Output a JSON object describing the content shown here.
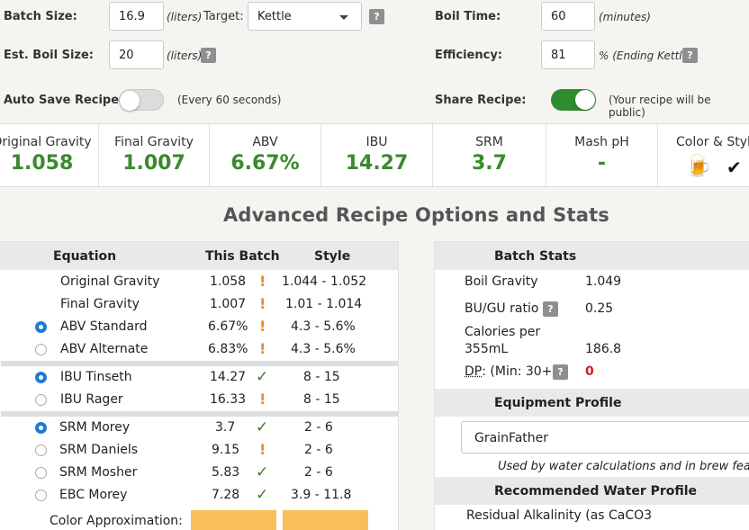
{
  "settings": {
    "batch_size_label": "Batch Size:",
    "batch_size_value": "16.9",
    "batch_size_unit": "(liters)",
    "target_label": "Target:",
    "target_value": "Kettle",
    "boil_time_label": "Boil Time:",
    "boil_time_value": "60",
    "boil_time_unit": "(minutes)",
    "est_boil_label": "Est. Boil Size:",
    "est_boil_value": "20",
    "est_boil_unit": "(liters)",
    "efficiency_label": "Efficiency:",
    "efficiency_value": "81",
    "efficiency_unit": "% (Ending Kettle)",
    "auto_save_label": "Auto Save Recipe:",
    "auto_save_note": "(Every 60 seconds)",
    "share_label": "Share Recipe:",
    "share_note": "(Your recipe will be public)",
    "help_glyph": "?"
  },
  "stats": [
    {
      "name": "Original Gravity",
      "value": "1.058"
    },
    {
      "name": "Final Gravity",
      "value": "1.007"
    },
    {
      "name": "ABV",
      "value": "6.67%"
    },
    {
      "name": "IBU",
      "value": "14.27"
    },
    {
      "name": "SRM",
      "value": "3.7"
    },
    {
      "name": "Mash pH",
      "value": "-"
    },
    {
      "name": "Color & Style",
      "value": ""
    }
  ],
  "stat_icons": {
    "beer": "🍺",
    "check": "✔"
  },
  "advanced_title": "Advanced Recipe Options and Stats",
  "equation_table": {
    "headers": {
      "equation": "Equation",
      "batch": "This Batch",
      "style": "Style"
    },
    "rows": [
      {
        "label": "Original Gravity",
        "batch": "1.058",
        "status": "!",
        "style": "1.044 - 1.052"
      },
      {
        "label": "Final Gravity",
        "batch": "1.007",
        "status": "!",
        "style": "1.01 - 1.014"
      },
      {
        "label": "ABV Standard",
        "batch": "6.67%",
        "status": "!",
        "style": "4.3 - 5.6%"
      },
      {
        "label": "ABV Alternate",
        "batch": "6.83%",
        "status": "!",
        "style": "4.3 - 5.6%"
      },
      {
        "label": "IBU Tinseth",
        "batch": "14.27",
        "status": "✓",
        "style": "8 - 15"
      },
      {
        "label": "IBU Rager",
        "batch": "16.33",
        "status": "!",
        "style": "8 - 15"
      },
      {
        "label": "SRM Morey",
        "batch": "3.7",
        "status": "✓",
        "style": "2 - 6"
      },
      {
        "label": "SRM Daniels",
        "batch": "9.15",
        "status": "!",
        "style": "2 - 6"
      },
      {
        "label": "SRM Mosher",
        "batch": "5.83",
        "status": "✓",
        "style": "2 - 6"
      },
      {
        "label": "EBC Morey",
        "batch": "7.28",
        "status": "✓",
        "style": "3.9 - 11.8"
      }
    ],
    "color_approx_label": "Color Approximation:",
    "swatch_color": "#f9be5a"
  },
  "batch_stats": {
    "header": "Batch Stats",
    "boil_gravity_label": "Boil Gravity",
    "boil_gravity_value": "1.049",
    "bugu_label": "BU/GU ratio",
    "bugu_value": "0.25",
    "calories_label_1": "Calories per",
    "calories_label_2": "355mL",
    "calories_value": "186.8",
    "dp_label": "DP",
    "dp_min": ": (Min: 30+)",
    "dp_value": "0"
  },
  "equipment": {
    "header": "Equipment Profile",
    "selected": "GrainFather",
    "note": "Used by water calculations and in brew featu"
  },
  "water": {
    "header": "Recommended Water Profile",
    "residual_label": "Residual Alkalinity (as CaCO3"
  }
}
